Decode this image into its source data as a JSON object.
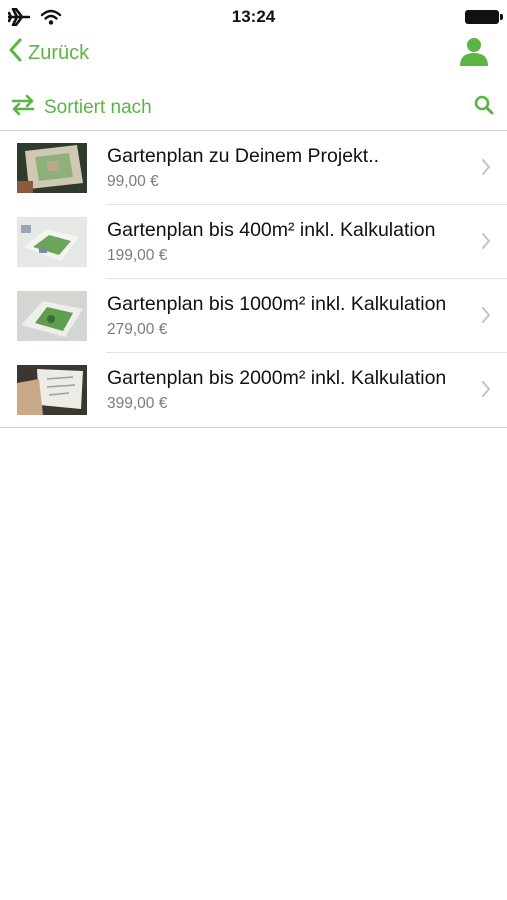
{
  "status_bar": {
    "time": "13:24",
    "icons": [
      "airplane-icon",
      "wifi-icon",
      "battery-icon"
    ]
  },
  "nav": {
    "back_label": "Zurück",
    "icons": [
      "chevron-left-icon",
      "user-icon"
    ]
  },
  "toolbar": {
    "sort_label": "Sortiert nach",
    "icons": [
      "sort-icon",
      "search-icon"
    ]
  },
  "products": [
    {
      "title": "Gartenplan zu Deinem Projekt..",
      "price": "99,00 €"
    },
    {
      "title": "Gartenplan bis 400m² inkl. Kalkulation",
      "price": "199,00 €"
    },
    {
      "title": "Gartenplan bis 1000m² inkl. Kalkulation",
      "price": "279,00 €"
    },
    {
      "title": "Gartenplan bis 2000m² inkl. Kalkulation",
      "price": "399,00 €"
    }
  ],
  "colors": {
    "accent": "#5bb446",
    "text": "#111111",
    "secondary_text": "#7c7c7c",
    "divider": "#e3e3e3"
  }
}
